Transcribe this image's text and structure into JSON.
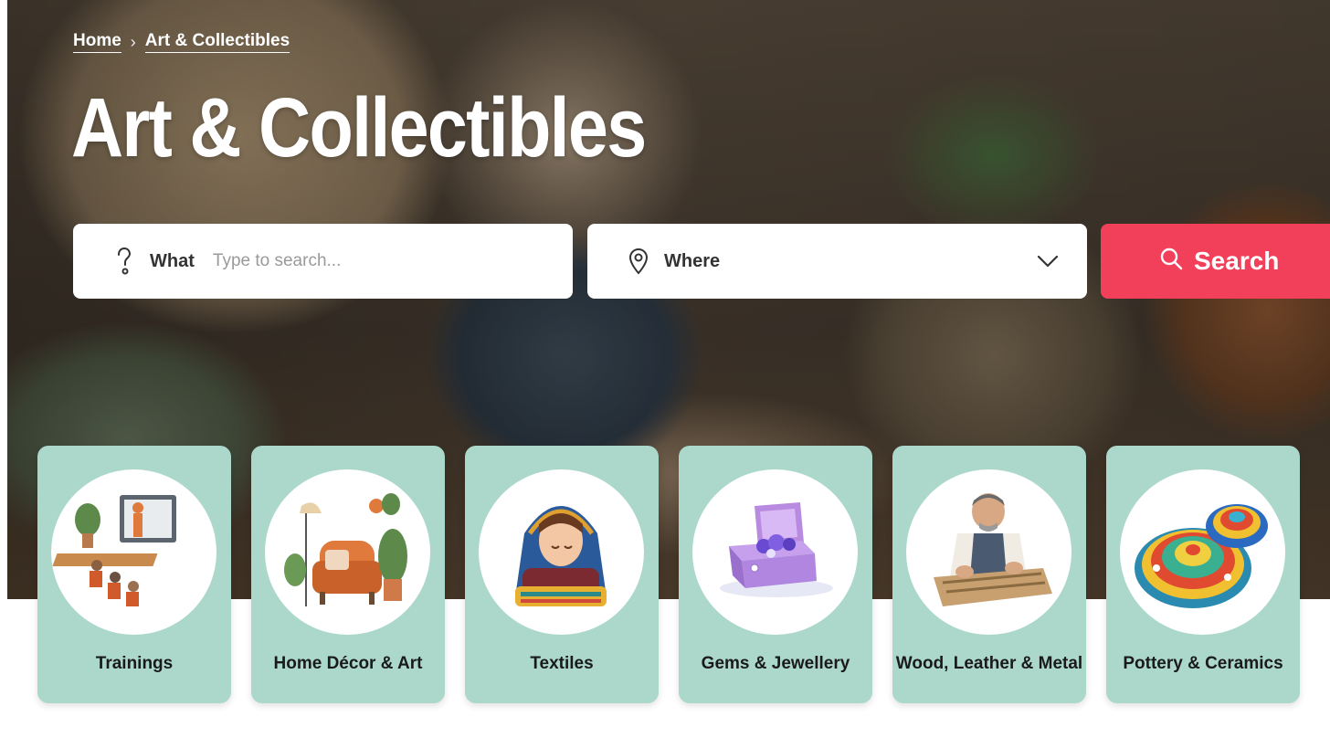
{
  "breadcrumb": {
    "home": "Home",
    "separator": "›",
    "current": "Art & Collectibles"
  },
  "page_title": "Art & Collectibles",
  "search": {
    "what_label": "What",
    "what_placeholder": "Type to search...",
    "where_label": "Where",
    "button_label": "Search"
  },
  "categories": [
    {
      "label": "Trainings",
      "icon": "training-illustration"
    },
    {
      "label": "Home Décor & Art",
      "icon": "armchair-illustration"
    },
    {
      "label": "Textiles",
      "icon": "embroidery-woman-illustration"
    },
    {
      "label": "Gems & Jewellery",
      "icon": "jewelry-box-illustration"
    },
    {
      "label": "Wood, Leather & Metal",
      "icon": "woodcarver-illustration"
    },
    {
      "label": "Pottery & Ceramics",
      "icon": "painted-plates-illustration"
    }
  ],
  "colors": {
    "accent": "#f2405a",
    "card_bg": "#acd8cc",
    "text": "#ffffff"
  }
}
